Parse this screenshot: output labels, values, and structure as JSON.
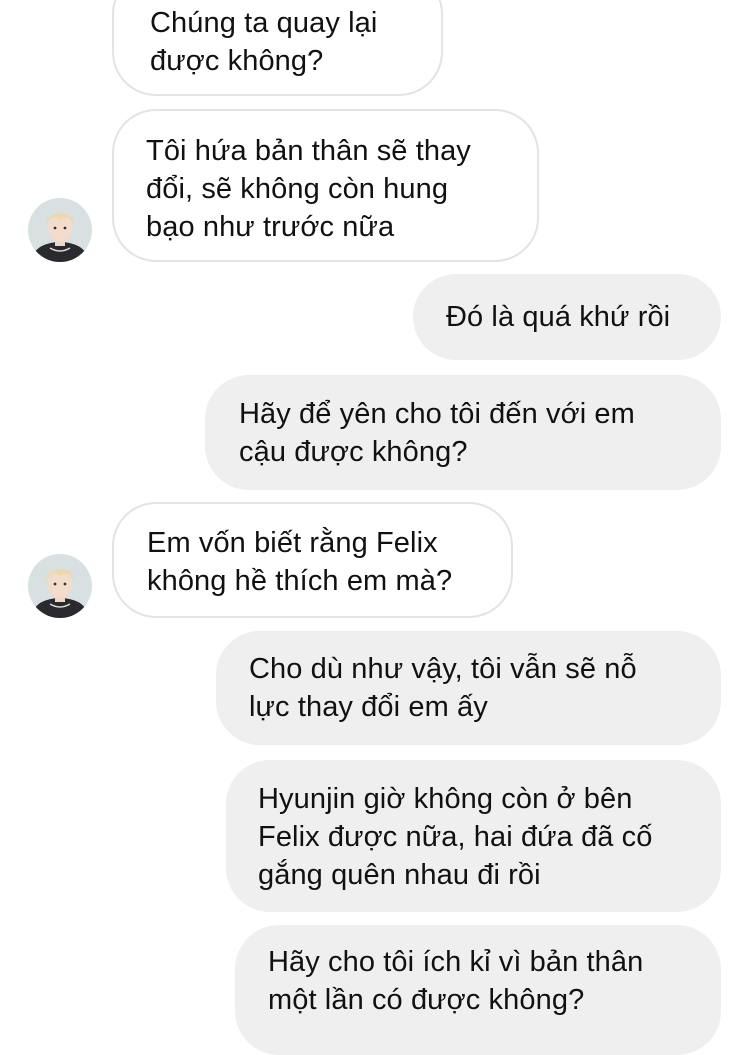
{
  "conversation": {
    "messages": [
      {
        "sender": "other",
        "text": "Chúng ta quay lại\nđược không?"
      },
      {
        "sender": "other",
        "text": "Tôi hứa bản thân sẽ thay\nđổi, sẽ không còn hung\nbạo như trước nữa"
      },
      {
        "sender": "me",
        "text": "Đó là quá khứ rồi"
      },
      {
        "sender": "me",
        "text": "Hãy để yên cho tôi đến với em\ncậu được không?"
      },
      {
        "sender": "other",
        "text": "Em vốn biết rằng Felix\nkhông hề thích em mà?"
      },
      {
        "sender": "me",
        "text": "Cho dù như vậy, tôi vẫn sẽ nỗ\nlực thay đổi em ấy"
      },
      {
        "sender": "me",
        "text": "Hyunjin giờ không còn ở bên\nFelix được nữa, hai đứa đã cố\ngắng quên nhau đi rồi"
      },
      {
        "sender": "me",
        "text": "Hãy cho tôi ích kỉ vì bản thân\nmột lần có được không?"
      }
    ]
  },
  "colors": {
    "incoming_bg": "#ffffff",
    "incoming_border": "#e3e3e3",
    "outgoing_bg": "#efefef",
    "text": "#111111"
  },
  "icons": {
    "avatar": "profile-photo"
  }
}
